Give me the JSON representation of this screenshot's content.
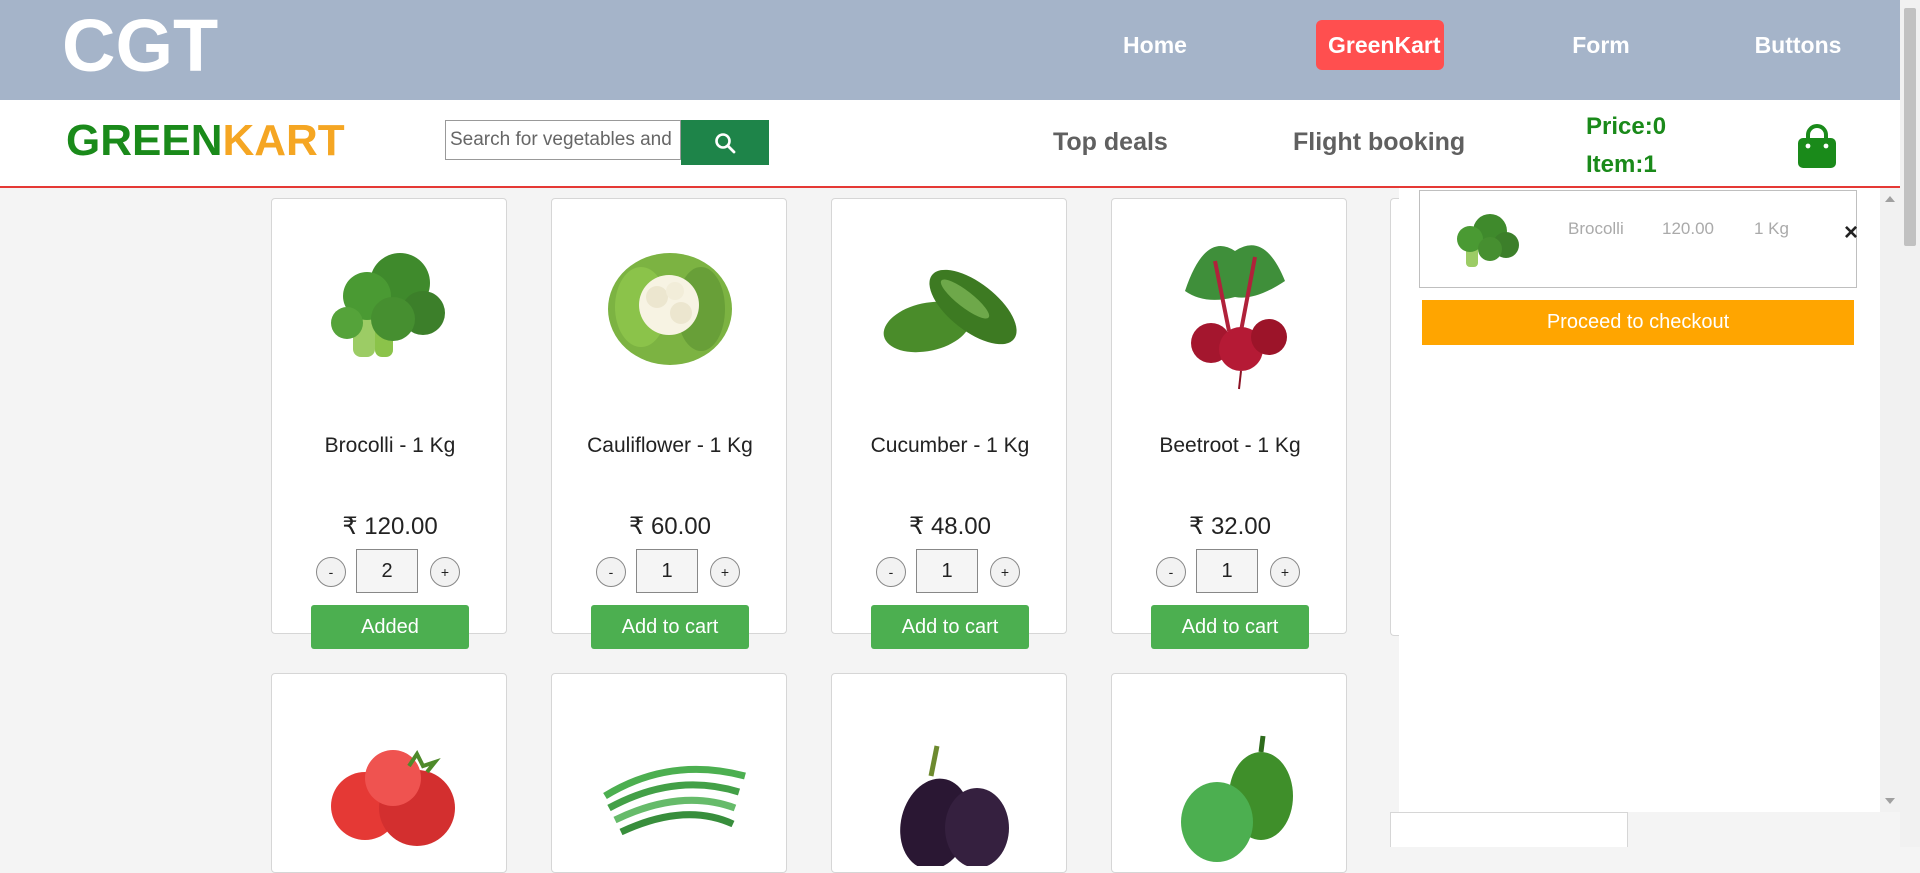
{
  "topnav": {
    "logo": "CGT",
    "links": [
      "Home",
      "GreenKart",
      "Form",
      "Buttons"
    ]
  },
  "header": {
    "brand_part1": "GREEN",
    "brand_part2": "KART",
    "search_placeholder": "Search for vegetables and fruits",
    "links": [
      "Top deals",
      "Flight booking"
    ],
    "price_label": "Price:0",
    "items_label": "Item:1"
  },
  "products": [
    {
      "name": "Brocolli - 1 Kg",
      "price": "₹ 120.00",
      "qty": "2",
      "button": "Added"
    },
    {
      "name": "Cauliflower - 1 Kg",
      "price": "₹ 60.00",
      "qty": "1",
      "button": "Add to cart"
    },
    {
      "name": "Cucumber - 1 Kg",
      "price": "₹ 48.00",
      "qty": "1",
      "button": "Add to cart"
    },
    {
      "name": "Beetroot - 1 Kg",
      "price": "₹ 32.00",
      "qty": "1",
      "button": "Add to cart"
    }
  ],
  "stepper": {
    "minus": "-",
    "plus": "+"
  },
  "cart": {
    "item_name": "Brocolli",
    "item_price": "120.00",
    "item_qty": "1 Kg",
    "remove": "×",
    "checkout": "Proceed to checkout"
  },
  "icons": [
    "search-icon",
    "shopping-bag-icon",
    "close-icon"
  ],
  "colors": {
    "topnav_bg": "#a5b4c9",
    "active_nav": "#ff4f4f",
    "brand_green": "#1a8a1a",
    "brand_orange": "#f5a623",
    "button_green": "#4caf50",
    "checkout_orange": "#ffa500"
  }
}
